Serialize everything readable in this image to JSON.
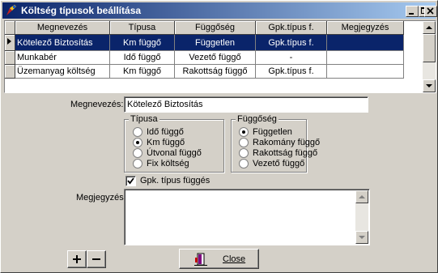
{
  "window": {
    "title": "Költség típusok beállítása"
  },
  "grid": {
    "columns": [
      "Megnevezés",
      "Típusa",
      "Függőség",
      "Gpk.típus f.",
      "Megjegyzés"
    ],
    "rows": [
      {
        "name": "Kötelező Biztosítás",
        "type": "Km függő",
        "dep": "Független",
        "gpk": "Gpk.típus f.",
        "note": ""
      },
      {
        "name": "Munkabér",
        "type": "Idő függő",
        "dep": "Vezető függő",
        "gpk": "-",
        "note": ""
      },
      {
        "name": "Üzemanyag költség",
        "type": "Km függő",
        "dep": "Rakottság függő",
        "gpk": "Gpk.típus f.",
        "note": ""
      }
    ],
    "selected_row": 0
  },
  "form": {
    "name_label": "Megnevezés:",
    "name_value": "Kötelező Biztosítás",
    "type_group": {
      "caption": "Típusa",
      "options": [
        "Idő függő",
        "Km függő",
        "Útvonal függő",
        "Fix költség"
      ],
      "selected": 1
    },
    "dep_group": {
      "caption": "Függőség",
      "options": [
        "Független",
        "Rakomány függő",
        "Rakottság függő",
        "Vezető függő"
      ],
      "selected": 0
    },
    "gpk_checkbox_label": "Gpk. típus függés",
    "gpk_checked": true,
    "note_label": "Megjegyzés:",
    "note_value": ""
  },
  "toolbar": {
    "add_label": "+",
    "remove_label": "−",
    "close_label": "Close"
  },
  "colors": {
    "selection": "#0a246a",
    "face": "#d4d0c8"
  }
}
